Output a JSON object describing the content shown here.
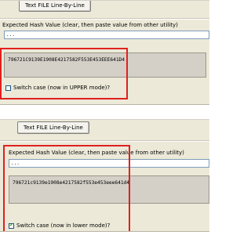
{
  "colors": {
    "highlight": "#e02020",
    "panel": "#ece9d8"
  },
  "top_panel": {
    "button_label": "Text FILE Line-By-Line",
    "expected_label": "Expected Hash Value (clear, then paste value from other utility)",
    "expected_value": "...",
    "hash_value": "796721C9139E1908E4217582F553E453EEE641D4",
    "switch_case_label": "Switch case (now in UPPER mode)?",
    "switch_case_checked": false
  },
  "bottom_panel": {
    "button_label": "Text FILE Line-By-Line",
    "expected_label": "Expected Hash Value (clear, then paste value from other utility)",
    "expected_value": "...",
    "hash_value": "796721c9139e1908e4217582f553e453eee641d4",
    "switch_case_label": "Switch case (now in lower mode)?",
    "switch_case_checked": true
  }
}
